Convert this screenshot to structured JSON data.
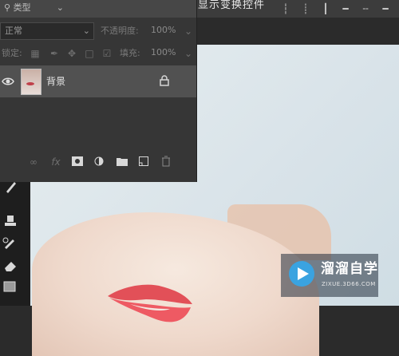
{
  "options_bar": {
    "transform_controls_label": "显示变换控件"
  },
  "layers_panel": {
    "filter": {
      "kind_label": "类型"
    },
    "blend_mode": {
      "value": "正常"
    },
    "opacity": {
      "label": "不透明度:",
      "value": "100%"
    },
    "lock": {
      "label": "锁定:"
    },
    "fill": {
      "label": "填充:",
      "value": "100%"
    },
    "layers": [
      {
        "name": "背景",
        "visible": true,
        "locked": true
      }
    ]
  },
  "watermark": {
    "name": "溜溜自学",
    "url": "ZIXUE.3D66.COM"
  },
  "colors": {
    "panel_bg": "#363636",
    "selected_layer": "#515151",
    "watermark_accent": "#3aa3e0"
  }
}
